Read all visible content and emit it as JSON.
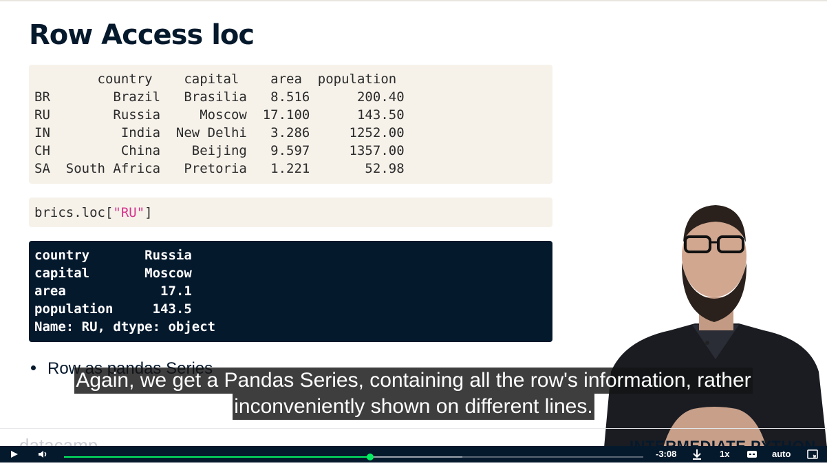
{
  "slide": {
    "title": "Row Access loc",
    "dataframe_lines": [
      "        country    capital    area  population",
      "BR        Brazil   Brasilia   8.516      200.40",
      "RU        Russia     Moscow  17.100      143.50",
      "IN         India  New Delhi   3.286     1252.00",
      "CH         China    Beijing   9.597     1357.00",
      "SA  South Africa   Pretoria   1.221       52.98"
    ],
    "command": {
      "prefix": "brics.loc[",
      "string": "\"RU\"",
      "suffix": "]"
    },
    "output_lines": [
      "country       Russia",
      "capital       Moscow",
      "area            17.1",
      "population     143.5",
      "Name: RU, dtype: object"
    ],
    "bullet": "Row as pandas Series",
    "logo_text": "datacamp",
    "course_label": "INTERMEDIATE PYTHON"
  },
  "subtitles": {
    "line1": "Again, we get a Pandas Series, containing all the row's information, rather",
    "line2": "inconveniently shown on different lines."
  },
  "player": {
    "time_remaining": "-3:08",
    "speed": "1x",
    "quality": "auto",
    "progress_fraction": 0.528,
    "buffered_fraction": 0.688,
    "accent_color": "#03ef62"
  }
}
